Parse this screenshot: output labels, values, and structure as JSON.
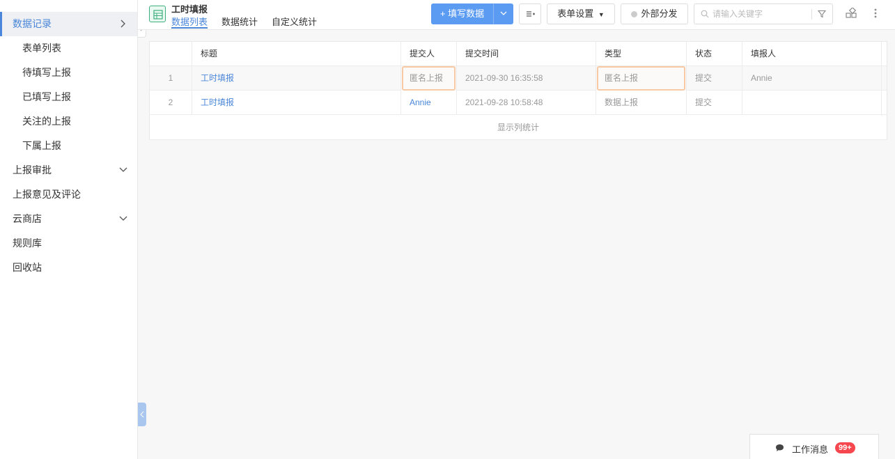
{
  "sidebar": {
    "items": [
      {
        "label": "数据记录"
      },
      {
        "label": "表单列表"
      },
      {
        "label": "待填写上报"
      },
      {
        "label": "已填写上报"
      },
      {
        "label": "关注的上报"
      },
      {
        "label": "下属上报"
      },
      {
        "label": "上报审批"
      },
      {
        "label": "上报意见及评论"
      },
      {
        "label": "云商店"
      },
      {
        "label": "规则库"
      },
      {
        "label": "回收站"
      }
    ]
  },
  "header": {
    "form_title": "工时填报",
    "tabs": [
      {
        "label": "数据列表"
      },
      {
        "label": "数据统计"
      },
      {
        "label": "自定义统计"
      }
    ],
    "fill_button": "+ 填写数据",
    "form_settings": "表单设置",
    "external_share": "外部分发",
    "search_placeholder": "请输入关键字"
  },
  "table": {
    "columns": [
      "",
      "标题",
      "提交人",
      "提交时间",
      "类型",
      "状态",
      "填报人"
    ],
    "rows": [
      {
        "index": "1",
        "title": "工时填报",
        "submitter": "匿名上报",
        "time": "2021-09-30 16:35:58",
        "type": "匿名上报",
        "status": "提交",
        "filler": "Annie"
      },
      {
        "index": "2",
        "title": "工时填报",
        "submitter": "Annie",
        "time": "2021-09-28 10:58:48",
        "type": "数据上报",
        "status": "提交",
        "filler": ""
      }
    ],
    "footer": "显示列统计"
  },
  "messages": {
    "label": "工作消息",
    "badge": "99+"
  },
  "colors": {
    "accent": "#4a86d9",
    "primary_button": "#5b9bf2",
    "highlight_border": "#f7c9a4",
    "badge": "#f5474d"
  }
}
